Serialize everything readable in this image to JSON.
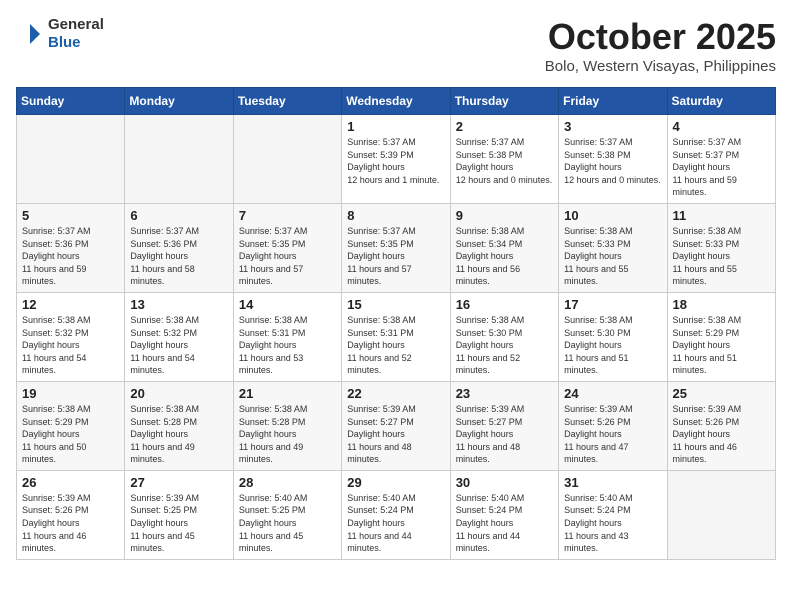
{
  "logo": {
    "general": "General",
    "blue": "Blue"
  },
  "title": "October 2025",
  "location": "Bolo, Western Visayas, Philippines",
  "weekdays": [
    "Sunday",
    "Monday",
    "Tuesday",
    "Wednesday",
    "Thursday",
    "Friday",
    "Saturday"
  ],
  "weeks": [
    [
      {
        "day": "",
        "empty": true
      },
      {
        "day": "",
        "empty": true
      },
      {
        "day": "",
        "empty": true
      },
      {
        "day": "1",
        "sunrise": "5:37 AM",
        "sunset": "5:39 PM",
        "daylight": "12 hours and 1 minute."
      },
      {
        "day": "2",
        "sunrise": "5:37 AM",
        "sunset": "5:38 PM",
        "daylight": "12 hours and 0 minutes."
      },
      {
        "day": "3",
        "sunrise": "5:37 AM",
        "sunset": "5:38 PM",
        "daylight": "12 hours and 0 minutes."
      },
      {
        "day": "4",
        "sunrise": "5:37 AM",
        "sunset": "5:37 PM",
        "daylight": "11 hours and 59 minutes."
      }
    ],
    [
      {
        "day": "5",
        "sunrise": "5:37 AM",
        "sunset": "5:36 PM",
        "daylight": "11 hours and 59 minutes."
      },
      {
        "day": "6",
        "sunrise": "5:37 AM",
        "sunset": "5:36 PM",
        "daylight": "11 hours and 58 minutes."
      },
      {
        "day": "7",
        "sunrise": "5:37 AM",
        "sunset": "5:35 PM",
        "daylight": "11 hours and 57 minutes."
      },
      {
        "day": "8",
        "sunrise": "5:37 AM",
        "sunset": "5:35 PM",
        "daylight": "11 hours and 57 minutes."
      },
      {
        "day": "9",
        "sunrise": "5:38 AM",
        "sunset": "5:34 PM",
        "daylight": "11 hours and 56 minutes."
      },
      {
        "day": "10",
        "sunrise": "5:38 AM",
        "sunset": "5:33 PM",
        "daylight": "11 hours and 55 minutes."
      },
      {
        "day": "11",
        "sunrise": "5:38 AM",
        "sunset": "5:33 PM",
        "daylight": "11 hours and 55 minutes."
      }
    ],
    [
      {
        "day": "12",
        "sunrise": "5:38 AM",
        "sunset": "5:32 PM",
        "daylight": "11 hours and 54 minutes."
      },
      {
        "day": "13",
        "sunrise": "5:38 AM",
        "sunset": "5:32 PM",
        "daylight": "11 hours and 54 minutes."
      },
      {
        "day": "14",
        "sunrise": "5:38 AM",
        "sunset": "5:31 PM",
        "daylight": "11 hours and 53 minutes."
      },
      {
        "day": "15",
        "sunrise": "5:38 AM",
        "sunset": "5:31 PM",
        "daylight": "11 hours and 52 minutes."
      },
      {
        "day": "16",
        "sunrise": "5:38 AM",
        "sunset": "5:30 PM",
        "daylight": "11 hours and 52 minutes."
      },
      {
        "day": "17",
        "sunrise": "5:38 AM",
        "sunset": "5:30 PM",
        "daylight": "11 hours and 51 minutes."
      },
      {
        "day": "18",
        "sunrise": "5:38 AM",
        "sunset": "5:29 PM",
        "daylight": "11 hours and 51 minutes."
      }
    ],
    [
      {
        "day": "19",
        "sunrise": "5:38 AM",
        "sunset": "5:29 PM",
        "daylight": "11 hours and 50 minutes."
      },
      {
        "day": "20",
        "sunrise": "5:38 AM",
        "sunset": "5:28 PM",
        "daylight": "11 hours and 49 minutes."
      },
      {
        "day": "21",
        "sunrise": "5:38 AM",
        "sunset": "5:28 PM",
        "daylight": "11 hours and 49 minutes."
      },
      {
        "day": "22",
        "sunrise": "5:39 AM",
        "sunset": "5:27 PM",
        "daylight": "11 hours and 48 minutes."
      },
      {
        "day": "23",
        "sunrise": "5:39 AM",
        "sunset": "5:27 PM",
        "daylight": "11 hours and 48 minutes."
      },
      {
        "day": "24",
        "sunrise": "5:39 AM",
        "sunset": "5:26 PM",
        "daylight": "11 hours and 47 minutes."
      },
      {
        "day": "25",
        "sunrise": "5:39 AM",
        "sunset": "5:26 PM",
        "daylight": "11 hours and 46 minutes."
      }
    ],
    [
      {
        "day": "26",
        "sunrise": "5:39 AM",
        "sunset": "5:26 PM",
        "daylight": "11 hours and 46 minutes."
      },
      {
        "day": "27",
        "sunrise": "5:39 AM",
        "sunset": "5:25 PM",
        "daylight": "11 hours and 45 minutes."
      },
      {
        "day": "28",
        "sunrise": "5:40 AM",
        "sunset": "5:25 PM",
        "daylight": "11 hours and 45 minutes."
      },
      {
        "day": "29",
        "sunrise": "5:40 AM",
        "sunset": "5:24 PM",
        "daylight": "11 hours and 44 minutes."
      },
      {
        "day": "30",
        "sunrise": "5:40 AM",
        "sunset": "5:24 PM",
        "daylight": "11 hours and 44 minutes."
      },
      {
        "day": "31",
        "sunrise": "5:40 AM",
        "sunset": "5:24 PM",
        "daylight": "11 hours and 43 minutes."
      },
      {
        "day": "",
        "empty": true
      }
    ]
  ]
}
